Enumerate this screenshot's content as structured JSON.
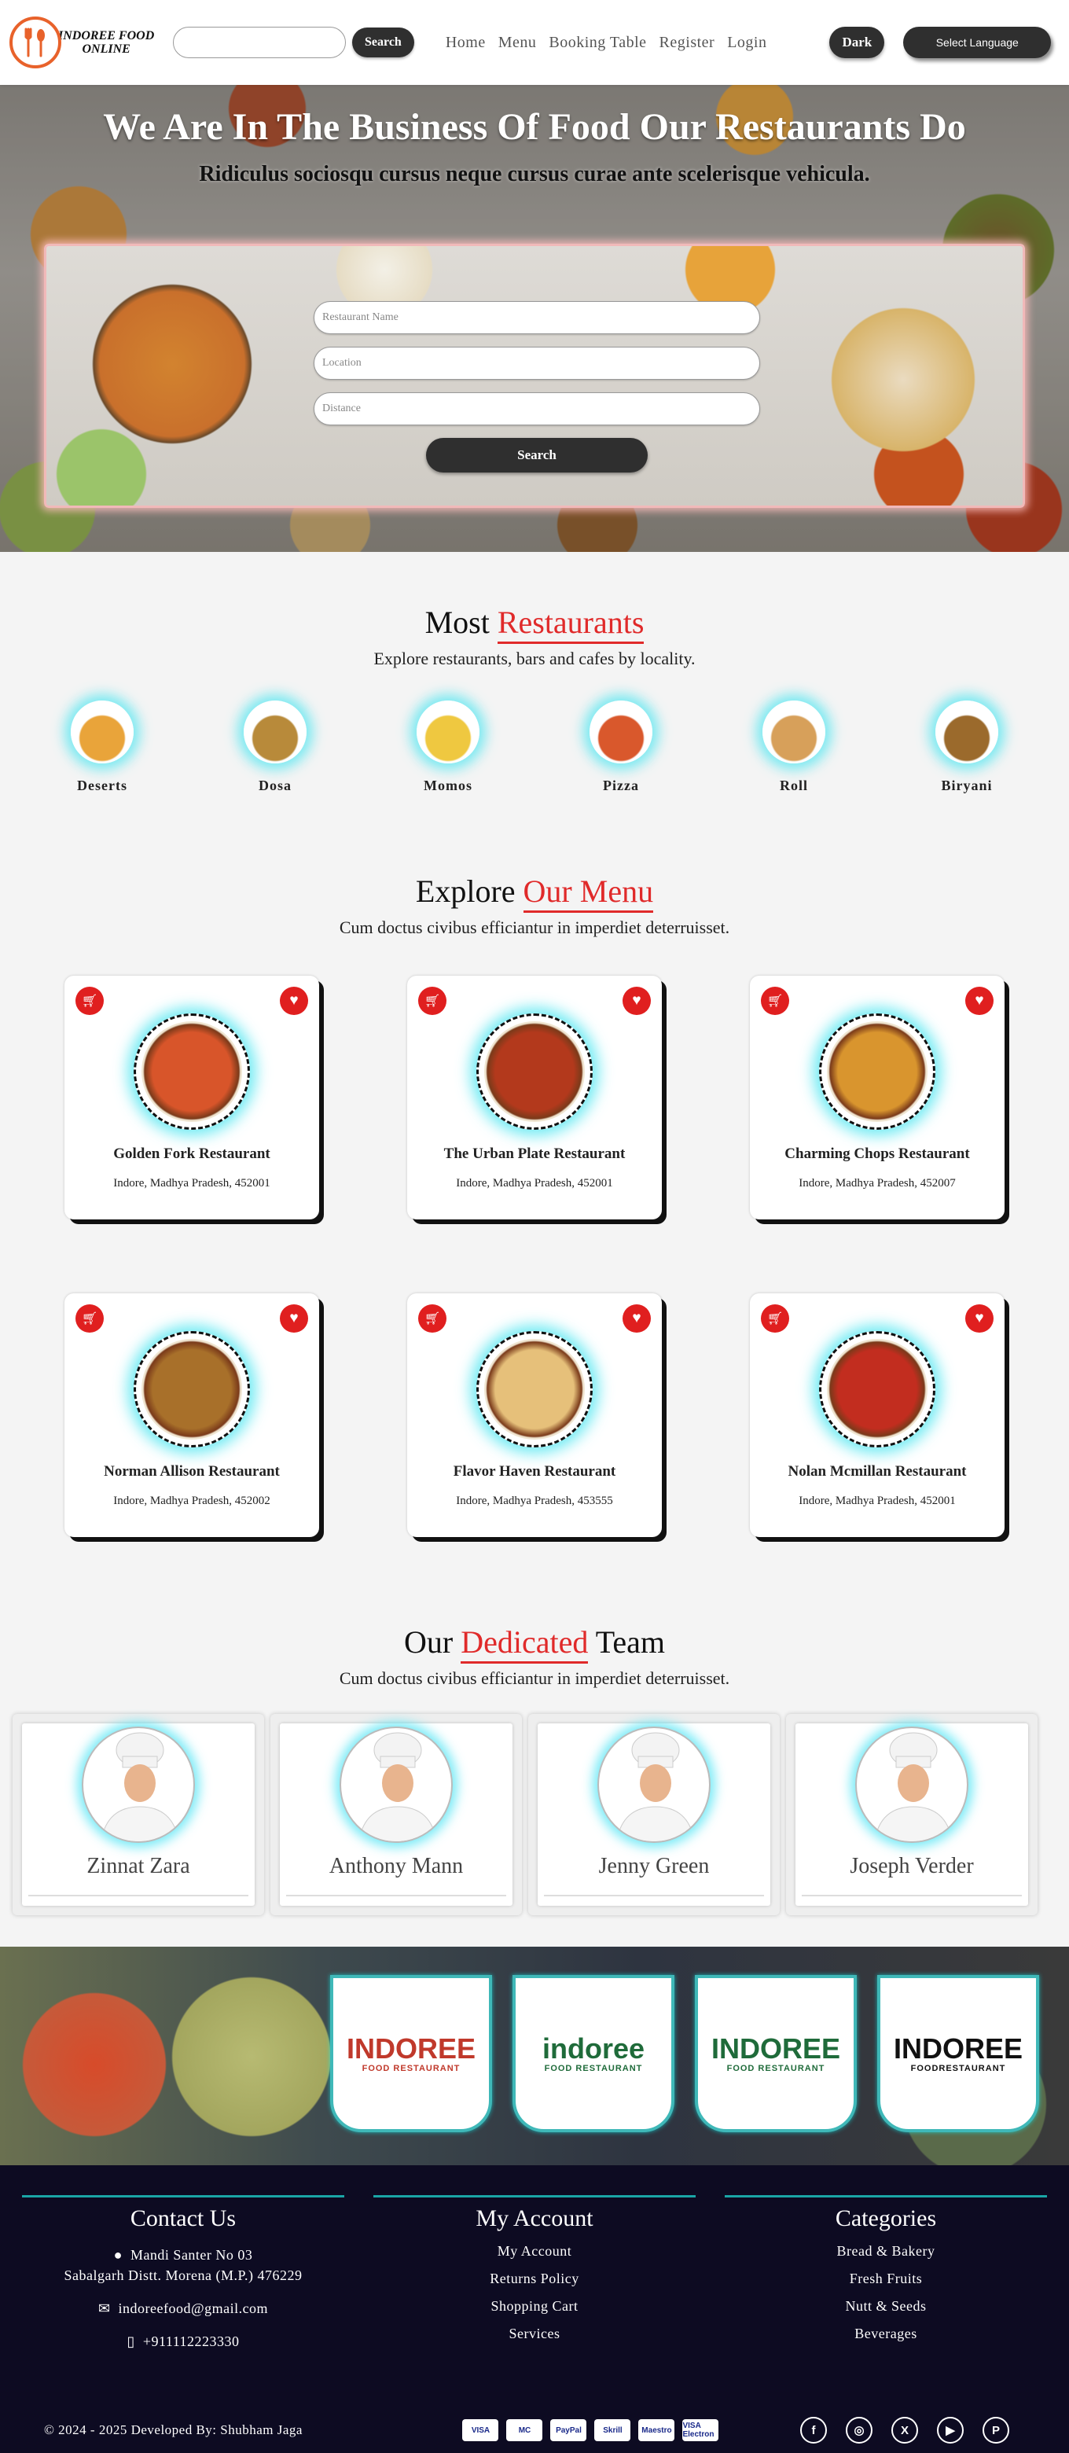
{
  "header": {
    "logo_text_line1": "INDOREE FOOD",
    "logo_text_line2": "ONLINE",
    "search_placeholder": "",
    "search_button": "Search",
    "nav": [
      "Home",
      "Menu",
      "Booking Table",
      "Register",
      "Login"
    ],
    "theme_button": "Dark",
    "language_button": "Select Language"
  },
  "hero": {
    "title": "We Are In The Business Of Food Our Restaurants Do",
    "subtitle": "Ridiculus sociosqu cursus neque cursus curae ante scelerisque vehicula.",
    "fields": [
      "Restaurant Name",
      "Location",
      "Distance"
    ],
    "search_button": "Search"
  },
  "most": {
    "title_plain": "Most",
    "title_accent": "Restaurants",
    "subtitle": "Explore restaurants, bars and cafes by locality.",
    "categories": [
      {
        "label": "Deserts",
        "icon": "dessert-icon",
        "color": "#e9a43a"
      },
      {
        "label": "Dosa",
        "icon": "dosa-icon",
        "color": "#b88a3a"
      },
      {
        "label": "Momos",
        "icon": "momos-icon",
        "color": "#efc840"
      },
      {
        "label": "Pizza",
        "icon": "pizza-icon",
        "color": "#d9582c"
      },
      {
        "label": "Roll",
        "icon": "roll-icon",
        "color": "#d7a05a"
      },
      {
        "label": "Biryani",
        "icon": "biryani-icon",
        "color": "#9b6a2c"
      }
    ]
  },
  "menu": {
    "title_plain": "Explore",
    "title_accent": "Our Menu",
    "subtitle": "Cum doctus civibus efficiantur in imperdiet deterruisset.",
    "cards": [
      {
        "name": "Golden Fork Restaurant",
        "address": "Indore, Madhya Pradesh, 452001",
        "color": "#d8552a"
      },
      {
        "name": "The Urban Plate Restaurant",
        "address": "Indore, Madhya Pradesh, 452001",
        "color": "#b3391c"
      },
      {
        "name": "Charming Chops Restaurant",
        "address": "Indore, Madhya Pradesh, 452007",
        "color": "#d9952e"
      },
      {
        "name": "Norman Allison Restaurant",
        "address": "Indore, Madhya Pradesh, 452002",
        "color": "#a8702a"
      },
      {
        "name": "Flavor Haven Restaurant",
        "address": "Indore, Madhya Pradesh, 453555",
        "color": "#e6c07a"
      },
      {
        "name": "Nolan Mcmillan Restaurant",
        "address": "Indore, Madhya Pradesh, 452001",
        "color": "#c22d1f"
      }
    ]
  },
  "team": {
    "title_plain1": "Our",
    "title_accent": "Dedicated",
    "title_plain2": "Team",
    "subtitle": "Cum doctus civibus efficiantur in imperdiet deterruisset.",
    "members": [
      "Zinnat Zara",
      "Anthony Mann",
      "Jenny Green",
      "Joseph Verder"
    ]
  },
  "brands": [
    {
      "line1": "INDOREE",
      "line2": "FOOD RESTAURANT",
      "color": "#c0392b"
    },
    {
      "line1": "indoree",
      "line2": "FOOD RESTAURANT",
      "color": "#1f6b3a"
    },
    {
      "line1": "INDOREE",
      "line2": "FOOD RESTAURANT",
      "color": "#1f6b3a"
    },
    {
      "line1": "INDOREE",
      "line2": "FOODRESTAURANT",
      "color": "#111111"
    }
  ],
  "footer": {
    "contact": {
      "title": "Contact Us",
      "address_line1": "Mandi Santer No 03",
      "address_line2": "Sabalgarh Distt. Morena (M.P.) 476229",
      "email": "indoreefood@gmail.com",
      "phone": "+911112223330"
    },
    "account": {
      "title": "My Account",
      "links": [
        "My Account",
        "Returns Policy",
        "Shopping Cart",
        "Services"
      ]
    },
    "categories": {
      "title": "Categories",
      "links": [
        "Bread & Bakery",
        "Fresh Fruits",
        "Nutt & Seeds",
        "Beverages"
      ]
    },
    "copyright": "© 2024 - 2025 Developed By: Shubham Jaga",
    "payments": [
      "VISA",
      "MC",
      "PayPal",
      "Skrill",
      "Maestro",
      "VISA Electron"
    ],
    "socials": [
      "facebook-icon",
      "instagram-icon",
      "x-icon",
      "youtube-icon",
      "pinterest-icon"
    ]
  }
}
